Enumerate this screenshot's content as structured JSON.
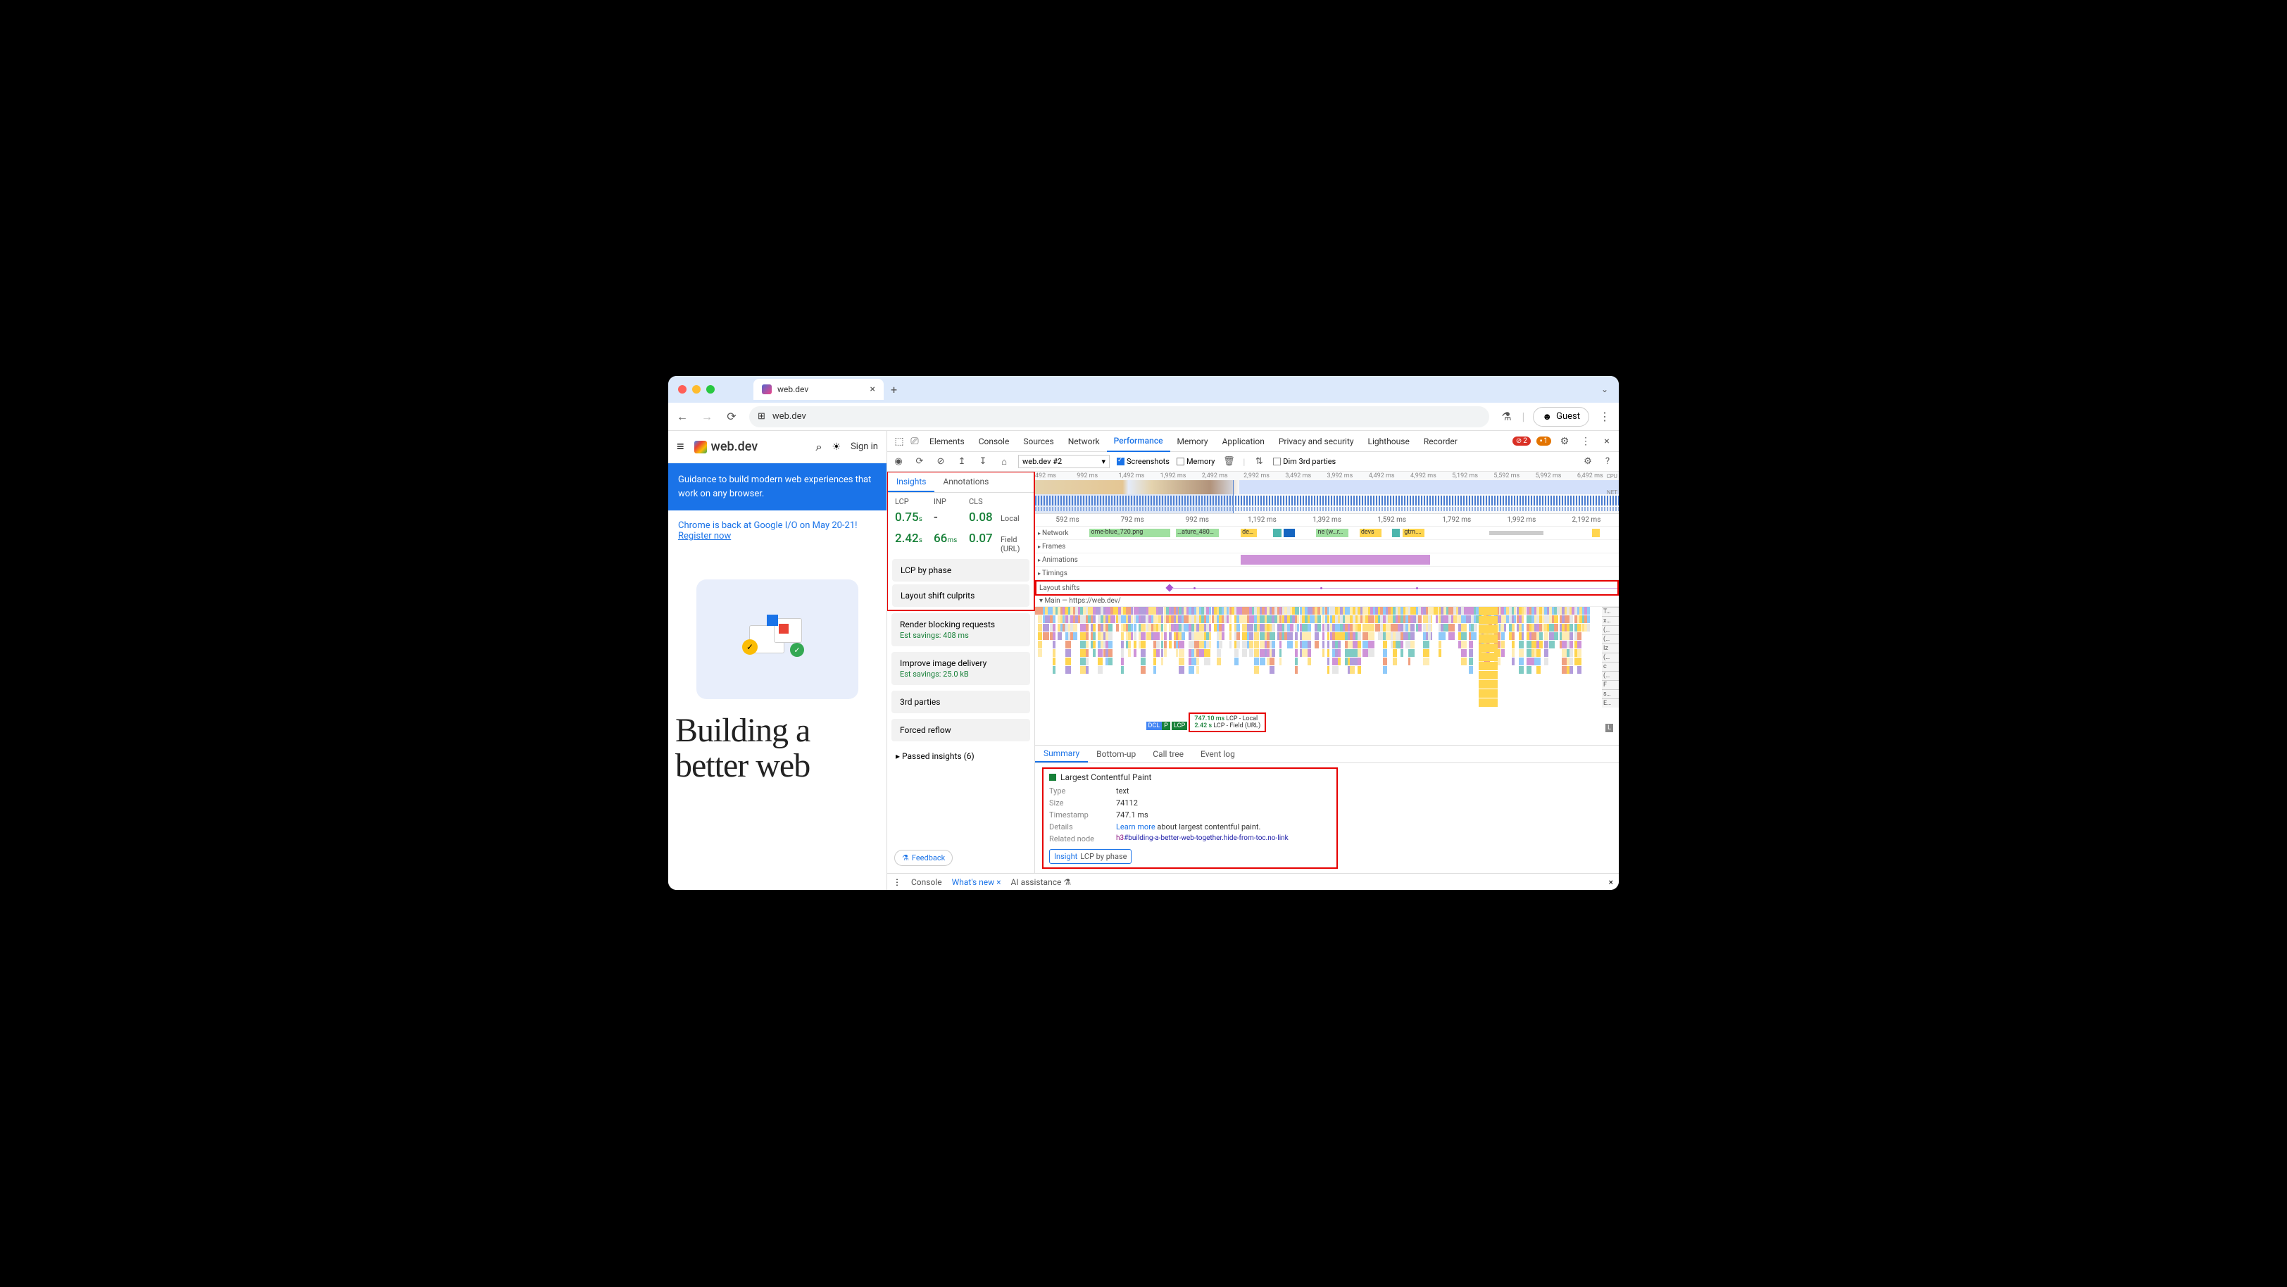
{
  "browser": {
    "tab_title": "web.dev",
    "url": "web.dev",
    "guest_label": "Guest"
  },
  "page": {
    "logo": "web.dev",
    "signin": "Sign in",
    "banner_blue": "Guidance to build modern web experiences that work on any browser.",
    "banner_io_text": "Chrome is back at Google I/O on May 20-21!",
    "banner_io_link": "Register now",
    "hero_title": "Building a better web"
  },
  "devtools": {
    "tabs": [
      "Elements",
      "Console",
      "Sources",
      "Network",
      "Performance",
      "Memory",
      "Application",
      "Privacy and security",
      "Lighthouse",
      "Recorder"
    ],
    "active_tab": "Performance",
    "errors": "2",
    "warnings": "1",
    "perf": {
      "recording": "web.dev #2",
      "check_screenshots": "Screenshots",
      "check_memory": "Memory",
      "check_dim3p": "Dim 3rd parties",
      "overview_ruler": [
        "492 ms",
        "992 ms",
        "1,492 ms",
        "1,992 ms",
        "2,492 ms",
        "2,992 ms",
        "3,492 ms",
        "3,992 ms",
        "4,492 ms",
        "4,992 ms",
        "5,192 ms",
        "5,592 ms",
        "5,992 ms",
        "6,492 ms"
      ],
      "overview_label_cpu": "CPU",
      "overview_label_net": "NET",
      "track_ruler": [
        "592 ms",
        "792 ms",
        "992 ms",
        "1,192 ms",
        "1,392 ms",
        "1,592 ms",
        "1,792 ms",
        "1,992 ms",
        "2,192 ms"
      ]
    },
    "insights": {
      "tabs": [
        "Insights",
        "Annotations"
      ],
      "metric_headers": [
        "LCP",
        "INP",
        "CLS"
      ],
      "local_label": "Local",
      "field_label": "Field (URL)",
      "local": {
        "lcp": "0.75",
        "lcp_unit": "s",
        "inp": "-",
        "cls": "0.08"
      },
      "field": {
        "lcp": "2.42",
        "lcp_unit": "s",
        "inp": "66",
        "inp_unit": "ms",
        "cls": "0.07"
      },
      "items": [
        {
          "title": "LCP by phase"
        },
        {
          "title": "Layout shift culprits"
        },
        {
          "title": "Render blocking requests",
          "savings": "Est savings: 408 ms"
        },
        {
          "title": "Improve image delivery",
          "savings": "Est savings: 25.0 kB"
        },
        {
          "title": "3rd parties"
        },
        {
          "title": "Forced reflow"
        }
      ],
      "passed": "Passed insights (6)",
      "feedback": "Feedback"
    },
    "tracks": {
      "network": "Network",
      "network_items": [
        "ome-blue_720.png",
        "…ature_480…",
        "de…",
        "ne (w…r…",
        "devs",
        "gtm.…"
      ],
      "frames": "Frames",
      "animations": "Animations",
      "timings": "Timings",
      "layout_shifts": "Layout shifts",
      "main": "Main — https://web.dev/",
      "flame_legend": [
        "T…",
        "x…",
        "(…",
        "(…",
        "Iz",
        "(…",
        "c",
        "(…",
        "F",
        "s…",
        "E…"
      ]
    },
    "lcp_marker": {
      "dcl": "DCL",
      "p": "P",
      "lcp": "LCP",
      "local_time": "747.10 ms",
      "local_label": "LCP - Local",
      "field_time": "2.42 s",
      "field_label": "LCP - Field (URL)",
      "l_badge": "L"
    },
    "detail_tabs": [
      "Summary",
      "Bottom-up",
      "Call tree",
      "Event log"
    ],
    "summary": {
      "title": "Largest Contentful Paint",
      "type_k": "Type",
      "type_v": "text",
      "size_k": "Size",
      "size_v": "74112",
      "timestamp_k": "Timestamp",
      "timestamp_v": "747.1 ms",
      "details_k": "Details",
      "details_link": "Learn more",
      "details_v": "about largest contentful paint.",
      "related_k": "Related node",
      "related_tag": "h3",
      "related_sel": "#building-a-better-web-together.hide-from-toc.no-link",
      "insight_lbl": "Insight",
      "insight_v": "LCP by phase"
    },
    "drawer": {
      "console": "Console",
      "whatsnew": "What's new",
      "ai": "AI assistance"
    }
  }
}
